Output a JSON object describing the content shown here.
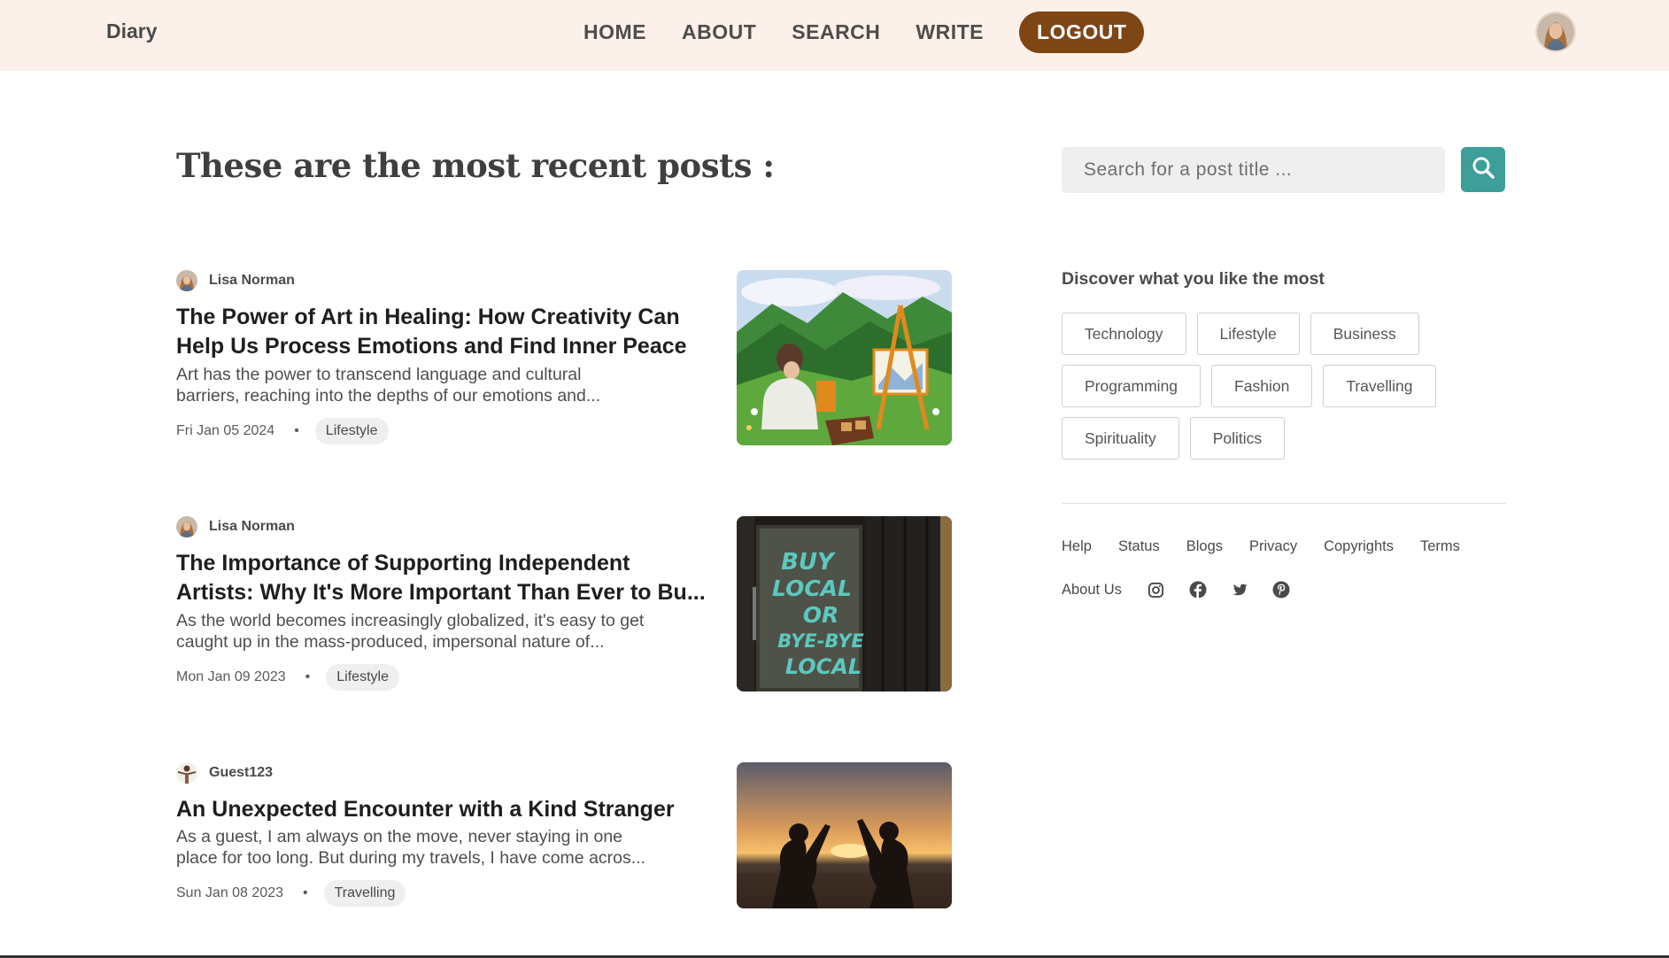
{
  "navbar": {
    "brand": "Diary",
    "links": [
      "HOME",
      "ABOUT",
      "SEARCH",
      "WRITE"
    ],
    "logout": "LOGOUT",
    "accent": "#7e4515",
    "background": "#fcf1ea"
  },
  "main": {
    "title": "These are the most recent posts :"
  },
  "posts": [
    {
      "author": "Lisa Norman",
      "title_lines": [
        "The Power of Art in Healing: How Creativity Can",
        "Help Us Process Emotions and Find Inner Peace"
      ],
      "excerpt_lines": [
        "Art has the power to transcend language and cultural",
        "barriers, reaching into the depths of our emotions and..."
      ],
      "date": "Fri Jan 05 2024",
      "category": "Lifestyle"
    },
    {
      "author": "Lisa Norman",
      "title_lines": [
        "The Importance of Supporting Independent",
        "Artists: Why It's More Important Than Ever to Bu..."
      ],
      "excerpt_lines": [
        "As the world becomes increasingly globalized, it's easy to get",
        "caught up in the mass-produced, impersonal nature of..."
      ],
      "date": "Mon Jan 09 2023",
      "category": "Lifestyle",
      "image_text": [
        "BUY",
        "LOCAL",
        "OR",
        "BYE-BYE",
        "LOCAL"
      ]
    },
    {
      "author": "Guest123",
      "title_lines": [
        "An Unexpected Encounter with a Kind Stranger"
      ],
      "excerpt_lines": [
        "As a guest, I am always on the move, never staying in one",
        "place for too long. But during my travels, I have come acros..."
      ],
      "date": "Sun Jan 08 2023",
      "category": "Travelling"
    }
  ],
  "sidebar": {
    "search_placeholder": "Search for a post title ...",
    "search_accent": "#3d9e9a",
    "discover_title": "Discover what you like the most",
    "tags": [
      "Technology",
      "Lifestyle",
      "Business",
      "Programming",
      "Fashion",
      "Travelling",
      "Spirituality",
      "Politics"
    ],
    "footer_links": [
      "Help",
      "Status",
      "Blogs",
      "Privacy",
      "Copyrights",
      "Terms"
    ],
    "about": "About Us",
    "social_icons": [
      "instagram-icon",
      "facebook-icon",
      "twitter-icon",
      "pinterest-icon"
    ]
  }
}
